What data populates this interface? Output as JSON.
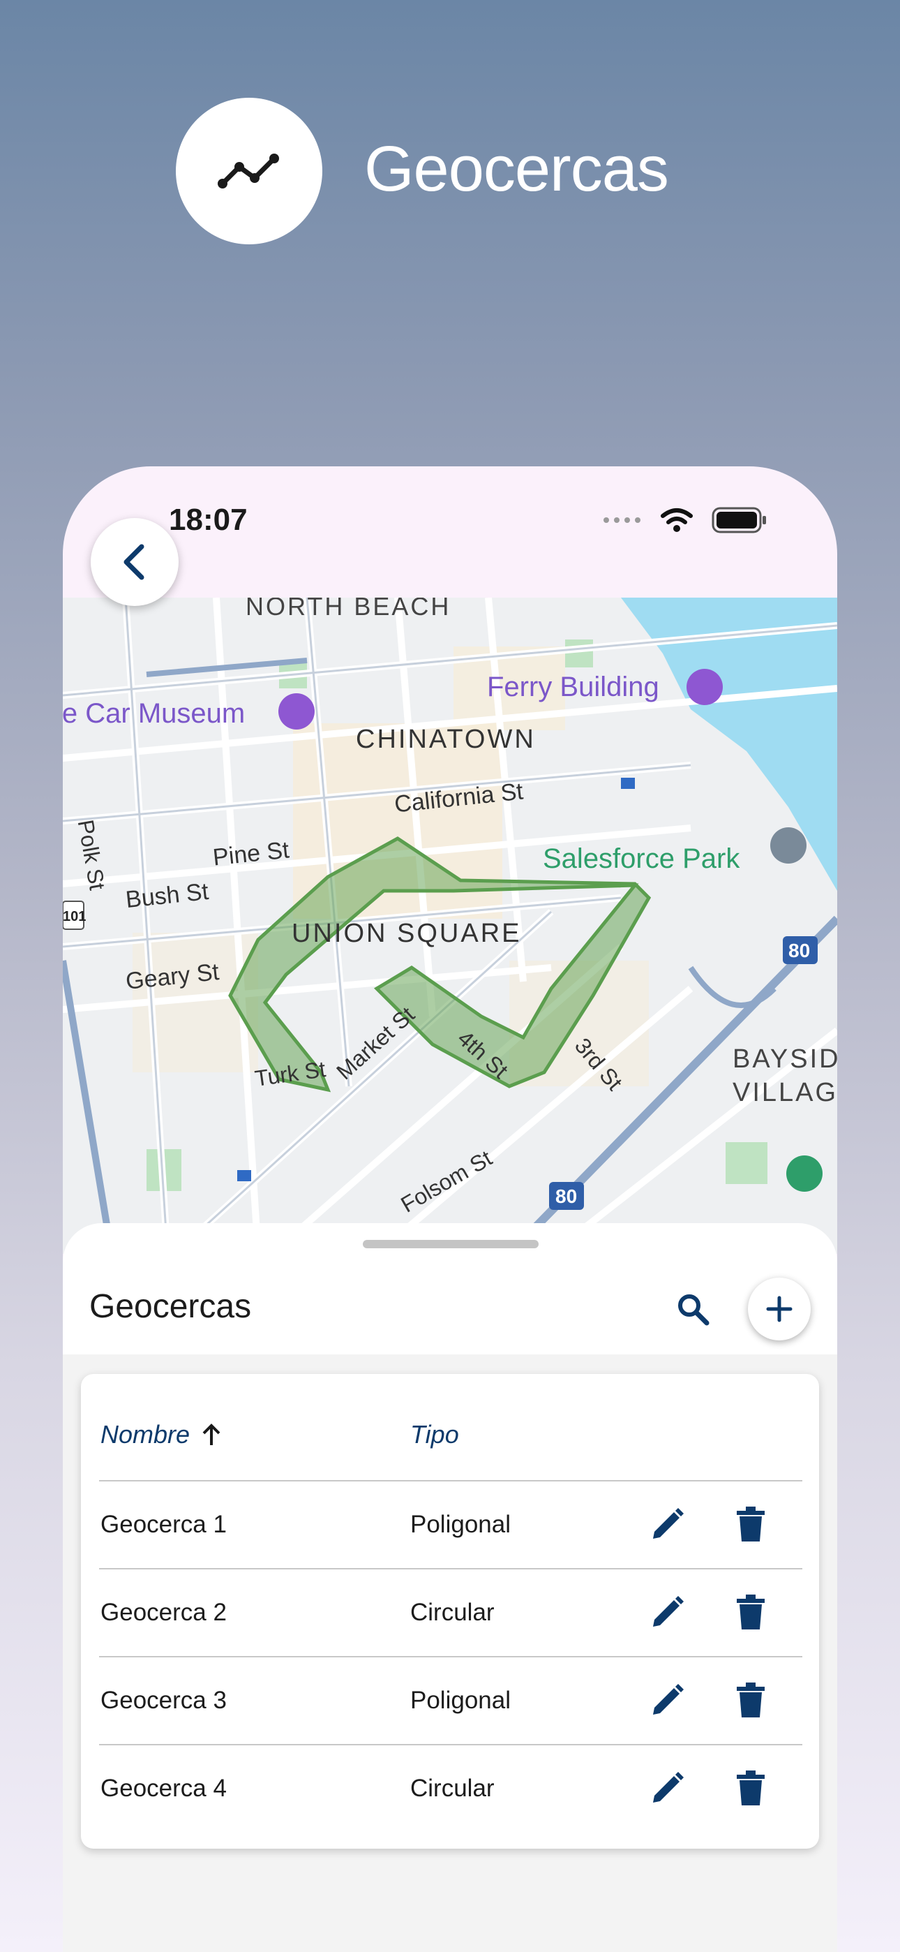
{
  "promo": {
    "title": "Geocercas",
    "icon": "polyline-chart-icon"
  },
  "status_bar": {
    "time": "18:07"
  },
  "map": {
    "labels": {
      "north_beach": "NORTH BEACH",
      "ferry_building": "Ferry Building",
      "car_museum": "le Car Museum",
      "chinatown": "CHINATOWN",
      "california_st": "California St",
      "polk_st": "Polk St",
      "pine_st": "Pine St",
      "salesforce_park": "Salesforce Park",
      "bush_st": "Bush St",
      "union_square": "UNION SQUARE",
      "geary_st": "Geary St",
      "market_st": "Market St",
      "fourth_st": "4th St",
      "third_st": "3rd St",
      "turk_st": "Turk St",
      "bayside": "BAYSID",
      "village": "VILLAG",
      "folsom_st": "Folsom St",
      "highway_80": "80",
      "highway_101": "101"
    },
    "geofence_color": "#5b9e4e"
  },
  "sheet": {
    "title": "Geocercas",
    "columns": {
      "name": "Nombre",
      "type": "Tipo"
    },
    "rows": [
      {
        "name": "Geocerca 1",
        "type": "Poligonal"
      },
      {
        "name": "Geocerca 2",
        "type": "Circular"
      },
      {
        "name": "Geocerca 3",
        "type": "Poligonal"
      },
      {
        "name": "Geocerca 4",
        "type": "Circular"
      }
    ]
  },
  "colors": {
    "accent": "#0d3a6b",
    "map_park": "#7b57c9",
    "map_green": "#2e9e6a"
  }
}
